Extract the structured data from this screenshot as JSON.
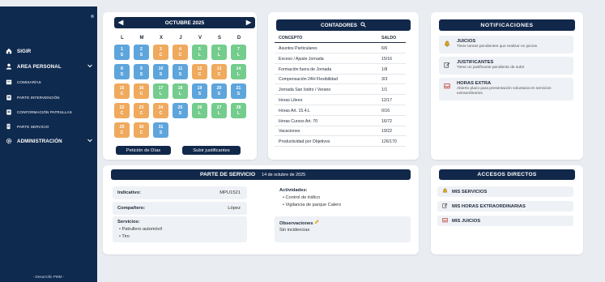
{
  "sidebar": {
    "items": [
      {
        "label": "SIGIR",
        "icon": "home-icon"
      },
      {
        "label": "AREA PERSONAL",
        "icon": "user-icon",
        "chevron": true
      },
      {
        "label": "COMISARÍAS",
        "icon": "building-icon"
      },
      {
        "label": "PARTE INTERVENCIÓN",
        "icon": "clipboard-icon"
      },
      {
        "label": "CONFORMACIÓN PATRULLAS",
        "icon": "clipboard-icon"
      },
      {
        "label": "PARTE SERVICIO",
        "icon": "document-icon"
      },
      {
        "label": "ADMINISTRACIÓN",
        "icon": "gear-icon",
        "chevron": true
      }
    ],
    "footer": "- Desarrollo PMM -"
  },
  "calendar": {
    "month": "OCTUBRE 2025",
    "weekdays": [
      "L",
      "M",
      "X",
      "J",
      "V",
      "S",
      "D"
    ],
    "days": [
      {
        "n": "1",
        "code": "S",
        "color": "blue",
        "col": 0,
        "row": 0
      },
      {
        "n": "2",
        "code": "S",
        "color": "blue",
        "col": 1,
        "row": 0
      },
      {
        "n": "3",
        "code": "C",
        "color": "orange",
        "col": 2,
        "row": 0
      },
      {
        "n": "4",
        "code": "C",
        "color": "orange",
        "col": 3,
        "row": 0
      },
      {
        "n": "5",
        "code": "L",
        "color": "green",
        "col": 4,
        "row": 0
      },
      {
        "n": "6",
        "code": "L",
        "color": "green",
        "col": 5,
        "row": 0
      },
      {
        "n": "7",
        "code": "L",
        "color": "green",
        "col": 6,
        "row": 0
      },
      {
        "n": "8",
        "code": "S",
        "color": "blue",
        "col": 0,
        "row": 1
      },
      {
        "n": "9",
        "code": "S",
        "color": "blue",
        "col": 1,
        "row": 1
      },
      {
        "n": "10",
        "code": "S",
        "color": "blue",
        "col": 2,
        "row": 1
      },
      {
        "n": "11",
        "code": "S",
        "color": "blue",
        "col": 3,
        "row": 1
      },
      {
        "n": "12",
        "code": "C",
        "color": "orange",
        "col": 4,
        "row": 1
      },
      {
        "n": "13",
        "code": "C",
        "color": "orange",
        "col": 5,
        "row": 1
      },
      {
        "n": "14",
        "code": "L",
        "color": "green",
        "col": 6,
        "row": 1
      },
      {
        "n": "15",
        "code": "C",
        "color": "orange",
        "col": 0,
        "row": 2
      },
      {
        "n": "16",
        "code": "C",
        "color": "orange",
        "col": 1,
        "row": 2
      },
      {
        "n": "17",
        "code": "L",
        "color": "green",
        "col": 2,
        "row": 2
      },
      {
        "n": "18",
        "code": "L",
        "color": "green",
        "col": 3,
        "row": 2
      },
      {
        "n": "19",
        "code": "S",
        "color": "blue",
        "col": 4,
        "row": 2
      },
      {
        "n": "20",
        "code": "S",
        "color": "blue",
        "col": 5,
        "row": 2
      },
      {
        "n": "21",
        "code": "S",
        "color": "blue",
        "col": 6,
        "row": 2
      },
      {
        "n": "22",
        "code": "C",
        "color": "orange",
        "col": 0,
        "row": 3
      },
      {
        "n": "23",
        "code": "C",
        "color": "orange",
        "col": 1,
        "row": 3
      },
      {
        "n": "24",
        "code": "C",
        "color": "orange",
        "col": 2,
        "row": 3
      },
      {
        "n": "25",
        "code": "S",
        "color": "blue",
        "col": 3,
        "row": 3
      },
      {
        "n": "26",
        "code": "L",
        "color": "green",
        "col": 4,
        "row": 3
      },
      {
        "n": "27",
        "code": "L",
        "color": "green",
        "col": 5,
        "row": 3
      },
      {
        "n": "28",
        "code": "L",
        "color": "green",
        "col": 6,
        "row": 3
      },
      {
        "n": "29",
        "code": "C",
        "color": "orange",
        "col": 0,
        "row": 4
      },
      {
        "n": "30",
        "code": "C",
        "color": "orange",
        "col": 1,
        "row": 4
      },
      {
        "n": "31",
        "code": "S",
        "color": "blue",
        "col": 2,
        "row": 4
      }
    ],
    "btn_request": "Petición de Días",
    "btn_upload": "Subir justificantes"
  },
  "counters": {
    "title": "CONTADORES",
    "col_concept": "CONCEPTO",
    "col_balance": "SALDO",
    "rows": [
      {
        "concept": "Asuntos Particulares",
        "balance": "6/6"
      },
      {
        "concept": "Exceso / Ajuste Jornada",
        "balance": "15/16"
      },
      {
        "concept": "Formación fuera de Jornada",
        "balance": "1/8"
      },
      {
        "concept": "Compensación 24H Flexibilidad",
        "balance": "3/3"
      },
      {
        "concept": "Jornada San Isidro / Verano",
        "balance": "1/1"
      },
      {
        "concept": "Horas Libres",
        "balance": "12/17"
      },
      {
        "concept": "Horas Art. 15.4.L",
        "balance": "0/16"
      },
      {
        "concept": "Horas Cursos Art. 70",
        "balance": "16/72"
      },
      {
        "concept": "Vacaciones",
        "balance": "19/22"
      },
      {
        "concept": "Productividad por Objetivos",
        "balance": "126/170"
      }
    ]
  },
  "notifications": {
    "title": "NOTIFICACIONES",
    "items": [
      {
        "title": "JUICIOS",
        "desc": "Tiene tareas pendientes que realizar en juicios",
        "icon": "bell-icon"
      },
      {
        "title": "JUSTIFICANTES",
        "desc": "Tiene un justificante pendiente de subir",
        "icon": "edit-icon"
      },
      {
        "title": "HORAS EXTRA",
        "desc": "Abierto plazo para presentación voluntaria en servicios extraordinarios",
        "icon": "inbox-icon"
      }
    ]
  },
  "service": {
    "title": "PARTE DE SERVICIO",
    "date": "14 de octubre de 2025",
    "indicativo_label": "Indicativo:",
    "indicativo_value": "MPU1521",
    "companero_label": "Compañero:",
    "companero_value": "López",
    "servicios_label": "Servicios:",
    "servicios": [
      "Patrullero automóvil",
      "Tiro"
    ],
    "actividades_label": "Actividades:",
    "actividades": [
      "Control de tráfico",
      "Vigilancia de parque Calero"
    ],
    "observaciones_label": "Observaciones",
    "observaciones_value": "Sin incidencias"
  },
  "shortcuts": {
    "title": "ACCESOS DIRECTOS",
    "items": [
      {
        "label": "MIS SERVICIOS",
        "icon": "bell-icon"
      },
      {
        "label": "MIS HORAS EXTRAORDINARIAS",
        "icon": "edit-icon"
      },
      {
        "label": "MIS JUICIOS",
        "icon": "inbox-icon"
      }
    ]
  },
  "colors": {
    "navy": "#11284a",
    "sidebar": "#0f2a4f",
    "blue_day": "#5ea5dc",
    "orange_day": "#efaa5e",
    "green_day": "#74cc8d",
    "bell": "#e0a321",
    "alert_red": "#c0392b"
  }
}
